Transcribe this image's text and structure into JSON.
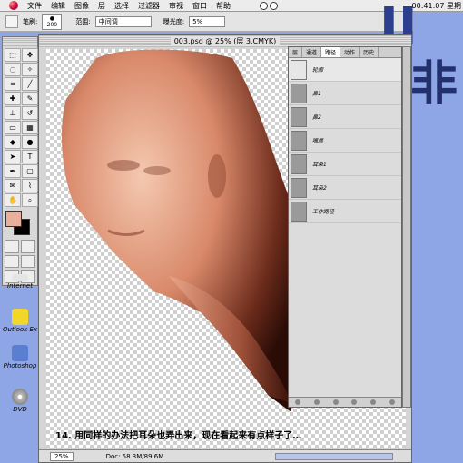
{
  "menu": {
    "items": [
      "文件",
      "编辑",
      "图像",
      "层",
      "选择",
      "过滤器",
      "审视",
      "窗口",
      "帮助"
    ],
    "clock": "00:41:07 星期"
  },
  "options": {
    "label_pen": "笔刷:",
    "brush_size": "200",
    "label_range": "范围:",
    "range_value": "中间调",
    "label_exposure": "曝光度:",
    "exposure_value": "5%"
  },
  "overlay_title": {
    "line1": "II",
    "line2": "非"
  },
  "document": {
    "title": "003.psd @ 25% (层 3,CMYK)",
    "caption": "14. 用同样的办法把耳朵也弄出来，现在看起来有点样子了…",
    "zoom": "25%",
    "doc_info": "Doc: 58.3M/89.6M"
  },
  "paths_panel": {
    "tabs": [
      "层",
      "通道",
      "路径",
      "动作",
      "历史"
    ],
    "active_tab": "路径",
    "paths": [
      "轮廓",
      "鼻1",
      "鼻2",
      "嘴唇",
      "耳朵1",
      "耳朵2",
      "工作路径"
    ]
  },
  "desktop_icons": [
    "Internet",
    "Outlook Ex",
    "Photoshop",
    "DVD"
  ],
  "colors": {
    "foreground": "#e8b09a",
    "background": "#000000",
    "desktop": "#8fa6e6"
  }
}
